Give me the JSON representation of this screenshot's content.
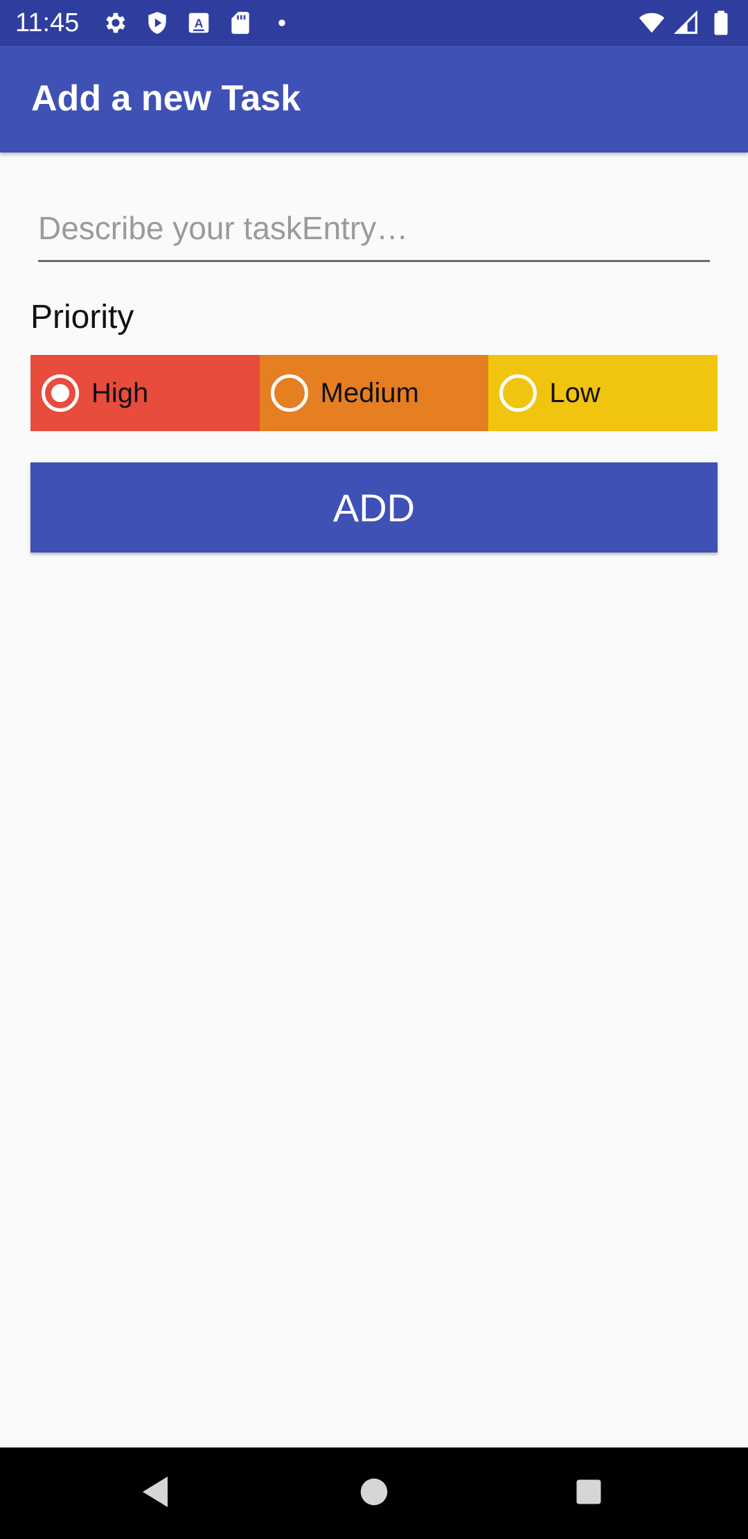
{
  "status_bar": {
    "time": "11:45",
    "left_icons": [
      "gear-icon",
      "shield-icon",
      "a-icon",
      "sd-card-icon",
      "dot-icon"
    ],
    "right_icons": [
      "wifi-icon",
      "signal-icon",
      "battery-icon"
    ],
    "background": "#2f3e9e"
  },
  "app_bar": {
    "title": "Add a new Task",
    "background": "#3f51b5"
  },
  "task_input": {
    "placeholder": "Describe your taskEntry…",
    "value": ""
  },
  "priority": {
    "label": "Priority",
    "selected": "High",
    "options": [
      {
        "label": "High",
        "color": "#e74c3c",
        "checked": true
      },
      {
        "label": "Medium",
        "color": "#e67e22",
        "checked": false
      },
      {
        "label": "Low",
        "color": "#f1c40f",
        "checked": false
      }
    ]
  },
  "add_button": {
    "label": "ADD",
    "color": "#3f51b5"
  },
  "nav_bar": {
    "buttons": [
      "back-icon",
      "home-icon",
      "recents-icon"
    ]
  }
}
